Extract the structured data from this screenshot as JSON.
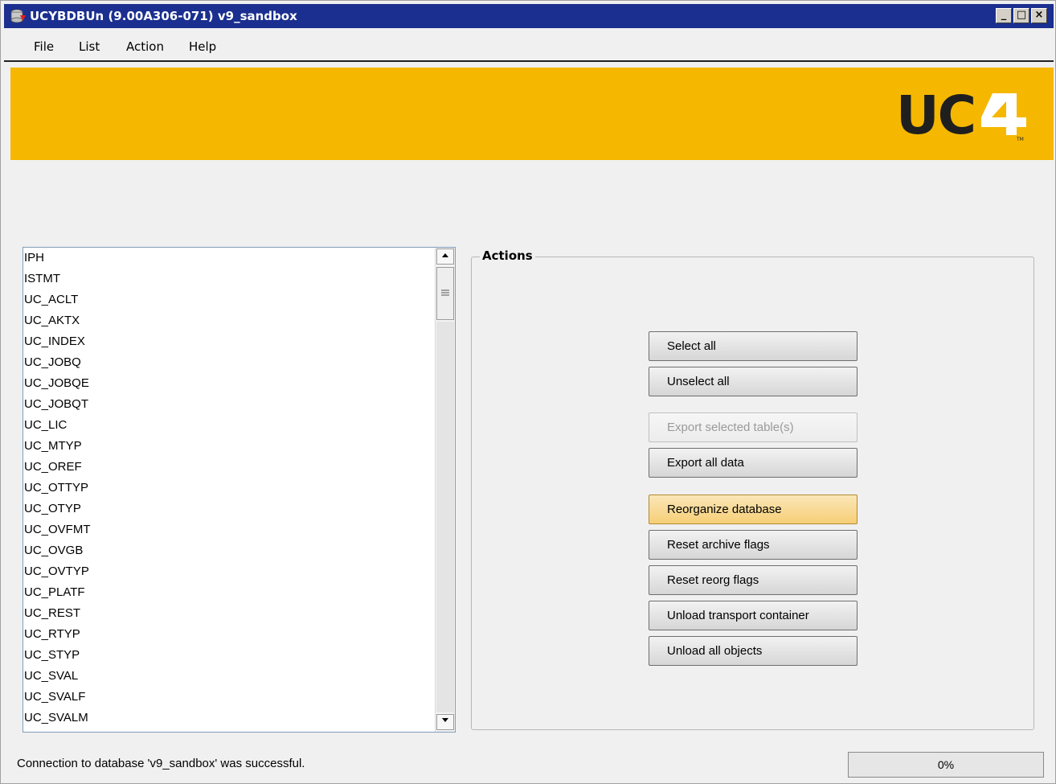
{
  "window": {
    "title": "UCYBDBUn (9.00A306-071) v9_sandbox",
    "app_icon": "database-export-icon",
    "buttons": {
      "minimize": "_",
      "maximize": "□",
      "close": "×"
    }
  },
  "menu": {
    "items": [
      "File",
      "List",
      "Action",
      "Help"
    ]
  },
  "banner": {
    "logo_text": "UC4",
    "brand_color": "#f5b700"
  },
  "table_list": {
    "items": [
      "IPH",
      "ISTMT",
      "UC_ACLT",
      "UC_AKTX",
      "UC_INDEX",
      "UC_JOBQ",
      "UC_JOBQE",
      "UC_JOBQT",
      "UC_LIC",
      "UC_MTYP",
      "UC_OREF",
      "UC_OTTYP",
      "UC_OTYP",
      "UC_OVFMT",
      "UC_OVGB",
      "UC_OVTYP",
      "UC_PLATF",
      "UC_REST",
      "UC_RTYP",
      "UC_STYP",
      "UC_SVAL",
      "UC_SVALF",
      "UC_SVALM"
    ]
  },
  "actions": {
    "title": "Actions",
    "select_all": "Select all",
    "unselect_all": "Unselect all",
    "export_selected": "Export selected table(s)",
    "export_all": "Export all data",
    "reorganize": "Reorganize database",
    "reset_archive": "Reset archive flags",
    "reset_reorg": "Reset reorg flags",
    "unload_transport": "Unload transport container",
    "unload_all": "Unload all objects"
  },
  "status": {
    "message": "Connection to database 'v9_sandbox' was successful.",
    "progress_value": 0,
    "progress_text": "0%"
  }
}
